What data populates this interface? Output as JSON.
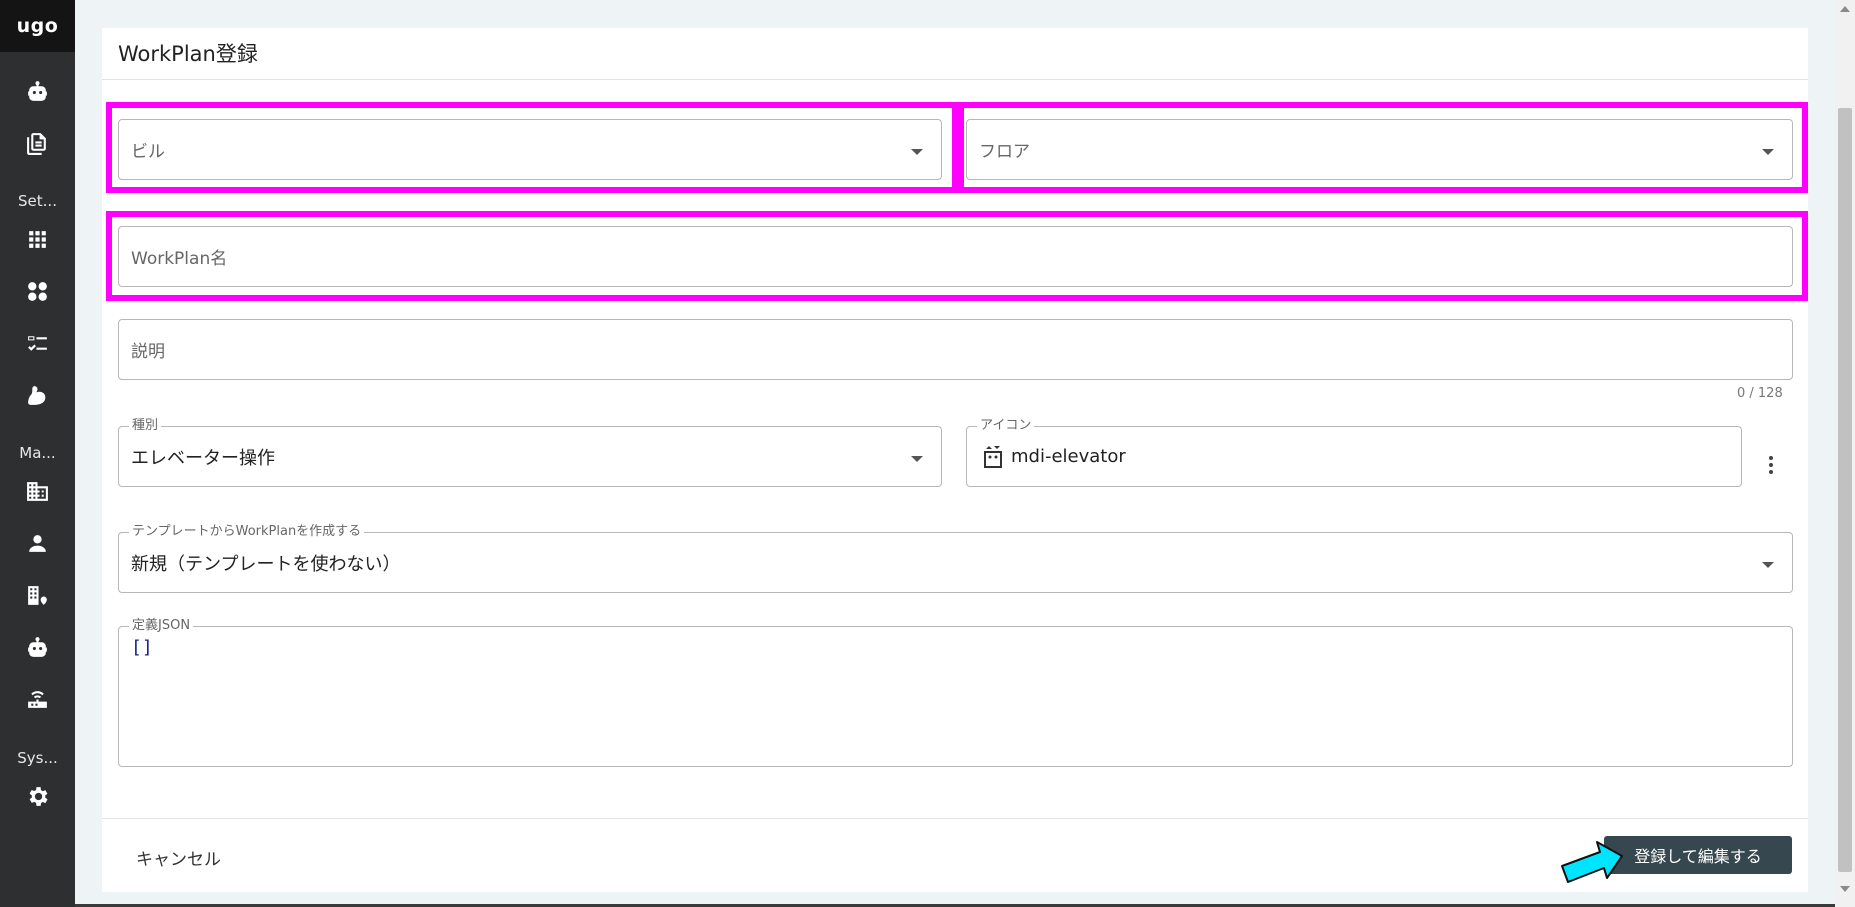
{
  "sidebar": {
    "logo": "ugo",
    "sections": {
      "settings": "Set...",
      "management": "Ma...",
      "system": "Sys..."
    },
    "icons": [
      "robot-icon",
      "document-icon",
      "grid-icon",
      "fan-icon",
      "checklist-icon",
      "arm-icon",
      "building-icon",
      "person-icon",
      "building-location-icon",
      "robot-icon",
      "router-icon",
      "gear-icon"
    ]
  },
  "page": {
    "title": "WorkPlan登録"
  },
  "form": {
    "building": {
      "placeholder": "ビル"
    },
    "floor": {
      "placeholder": "フロア"
    },
    "workplan_name": {
      "placeholder": "WorkPlan名"
    },
    "description": {
      "placeholder": "説明",
      "counter": "0 / 128"
    },
    "type": {
      "label": "種別",
      "value": "エレベーター操作"
    },
    "icon": {
      "label": "アイコン",
      "value": "mdi-elevator"
    },
    "template": {
      "label": "テンプレートからWorkPlanを作成する",
      "value": "新規（テンプレートを使わない）"
    },
    "json": {
      "label": "定義JSON",
      "value": "[]"
    }
  },
  "footer": {
    "cancel": "キャンセル",
    "submit": "登録して編集する"
  },
  "colors": {
    "highlight": "#ff00ff",
    "arrow": "#00e5ff",
    "primary_button": "#37474f",
    "sidebar": "#2e2f30"
  }
}
